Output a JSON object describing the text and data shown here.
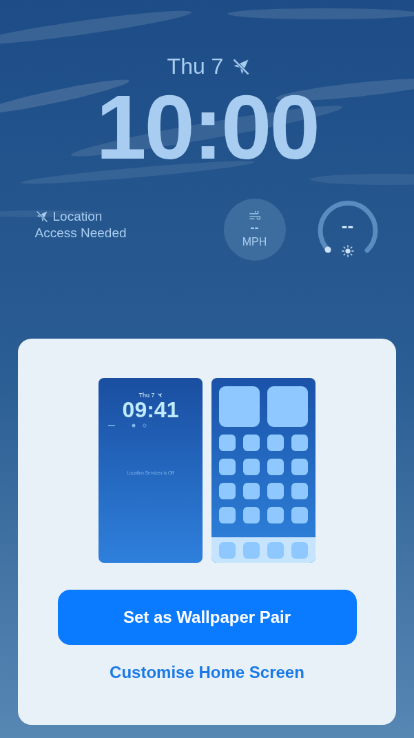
{
  "lock_screen": {
    "date": "Thu 7",
    "time": "10:00",
    "location_widget": {
      "line_1": "Location",
      "line_2": "Access Needed"
    },
    "wind_widget": {
      "value": "--",
      "unit": "MPH"
    },
    "gauge_widget": {
      "value": "--"
    }
  },
  "wallpaper_sheet": {
    "lock_preview": {
      "date": "Thu 7",
      "time": "09:41",
      "notice": "Location Services is Off"
    },
    "primary_button": "Set as Wallpaper Pair",
    "secondary_link": "Customise Home Screen"
  }
}
